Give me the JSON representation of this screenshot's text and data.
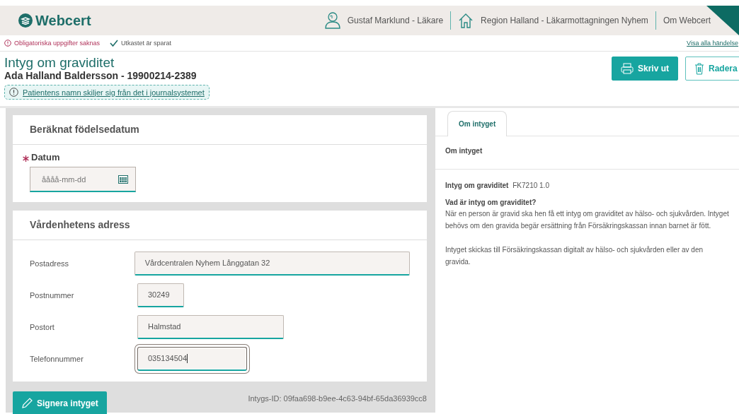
{
  "header": {
    "logo": "Webcert",
    "user": "Gustaf Marklund - Läkare",
    "unit": "Region Halland - Läkarmottagningen Nyhem",
    "about": "Om Webcert"
  },
  "status": {
    "error": "Obligatoriska uppgifter saknas",
    "saved": "Utkastet är sparat",
    "events_link": "Visa alla händelse"
  },
  "certificate": {
    "title": "Intyg om graviditet",
    "patient": "Ada Halland Baldersson - 19900214-2389",
    "notice": "Patientens namn skiljer sig från det i journalsystemet"
  },
  "buttons": [
    {
      "label": "Skriv ut",
      "kind": "print"
    },
    {
      "label": "Radera",
      "kind": "delete"
    }
  ],
  "sections": [
    {
      "title": "Beräknat födelsedatum",
      "fields": [
        {
          "kind": "date",
          "label": "Datum",
          "required": true,
          "placeholder": "åååå-mm-dd",
          "focused": false
        }
      ]
    },
    {
      "title": "Vårdenhetens adress",
      "fields": [
        {
          "kind": "text",
          "label": "Postadress",
          "required": false,
          "value": "Vårdcentralen Nyhem Långgatan 32",
          "focused": false
        },
        {
          "kind": "text",
          "label": "Postnummer",
          "required": false,
          "value": "30249",
          "focused": false
        },
        {
          "kind": "text",
          "label": "Postort",
          "required": false,
          "value": "Halmstad",
          "focused": false
        },
        {
          "kind": "text",
          "label": "Telefonnummer",
          "required": false,
          "value": "035134504",
          "focused": true
        }
      ]
    }
  ],
  "sign_button": "Signera intyget",
  "certificate_id": "Intygs-ID: 09faa698-b9ee-4c63-94bf-65da36939cc8",
  "side_panel": {
    "tabs": [
      {
        "label": "Om intyget",
        "selected": true
      }
    ],
    "heading": "Om intyget",
    "name": "Intyg om graviditet",
    "code": "FK7210 1.0",
    "question": "Vad är intyg om graviditet?",
    "paragraphs": [
      "När en person är gravid ska hen få ett intyg om graviditet av hälso- och sjukvården. Intyget behövs om den gravida begär ersättning från Försäkringskassan innan barnet är fött.",
      "Intyget skickas till Försäkringskassan digitalt av hälso- och sjukvården eller av den gravida."
    ]
  }
}
